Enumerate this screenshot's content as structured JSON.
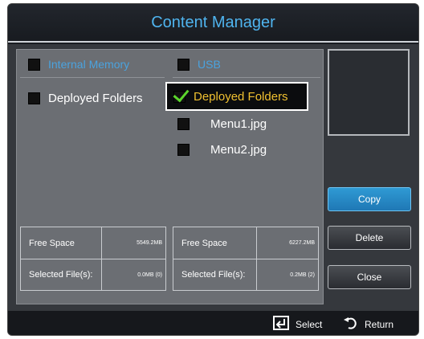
{
  "window": {
    "title": "Content Manager"
  },
  "left_pane": {
    "header": "Internal Memory",
    "items": [
      {
        "label": "Deployed Folders",
        "checked": false
      }
    ],
    "info": [
      {
        "key": "Free Space",
        "value": "5549.2MB"
      },
      {
        "key": "Selected File(s):",
        "value": "0.0MB (0)"
      }
    ]
  },
  "right_pane": {
    "header": "USB",
    "items": [
      {
        "label": "Deployed Folders",
        "checked": true,
        "focused": true
      },
      {
        "label": "Menu1.jpg",
        "checked": false
      },
      {
        "label": "Menu2.jpg",
        "checked": false
      }
    ],
    "info": [
      {
        "key": "Free Space",
        "value": "6227.2MB"
      },
      {
        "key": "Selected File(s):",
        "value": "0.2MB (2)"
      }
    ]
  },
  "buttons": {
    "copy": "Copy",
    "delete": "Delete",
    "close": "Close"
  },
  "footer": {
    "select": "Select",
    "return": "Return"
  },
  "colors": {
    "accent": "#4fb4ef",
    "focus_text": "#f0c030",
    "check": "#5cd62c",
    "active_button": "#2f9ad4"
  },
  "icons": {
    "select": "enter-icon",
    "return": "return-arrow-icon",
    "check": "check-icon"
  }
}
